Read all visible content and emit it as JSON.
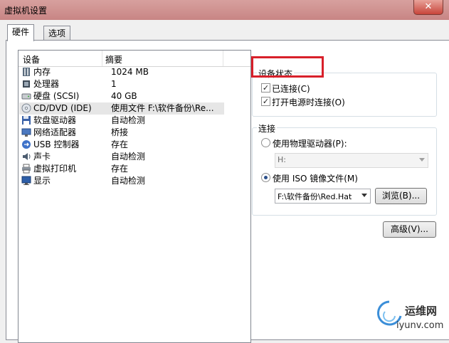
{
  "window": {
    "title": "虚拟机设置"
  },
  "tabs": [
    {
      "label": "硬件"
    },
    {
      "label": "选项"
    }
  ],
  "device_list": {
    "columns": {
      "device": "设备",
      "summary": "摘要"
    },
    "rows": [
      {
        "name": "内存",
        "summary": "1024 MB",
        "icon": "memory-icon"
      },
      {
        "name": "处理器",
        "summary": "1",
        "icon": "processor-icon"
      },
      {
        "name": "硬盘 (SCSI)",
        "summary": "40 GB",
        "icon": "harddisk-icon"
      },
      {
        "name": "CD/DVD (IDE)",
        "summary": "使用文件 F:\\软件备份\\Re...",
        "icon": "cdrom-icon"
      },
      {
        "name": "软盘驱动器",
        "summary": "自动检测",
        "icon": "floppy-icon"
      },
      {
        "name": "网络适配器",
        "summary": "桥接",
        "icon": "network-icon"
      },
      {
        "name": "USB 控制器",
        "summary": "存在",
        "icon": "usb-icon"
      },
      {
        "name": "声卡",
        "summary": "自动检测",
        "icon": "sound-icon"
      },
      {
        "name": "虚拟打印机",
        "summary": "存在",
        "icon": "printer-icon"
      },
      {
        "name": "显示",
        "summary": "自动检测",
        "icon": "display-icon"
      }
    ]
  },
  "device_status": {
    "title": "设备状态",
    "connected": {
      "label": "已连接(C)",
      "checked": true
    },
    "connect_at_power_on": {
      "label": "打开电源时连接(O)",
      "checked": true
    }
  },
  "connection": {
    "title": "连接",
    "physical": {
      "label": "使用物理驱动器(P):",
      "selected": false,
      "value": "H:"
    },
    "iso": {
      "label": "使用 ISO 镜像文件(M)",
      "selected": true,
      "value": "F:\\软件备份\\Red.Hat"
    },
    "browse_label": "浏览(B)..."
  },
  "advanced_label": "高级(V)...",
  "watermark": {
    "text": "运维网",
    "url": "iyunv.com"
  },
  "colors": {
    "highlight": "#d8202a",
    "titlebar": "#c88584"
  }
}
